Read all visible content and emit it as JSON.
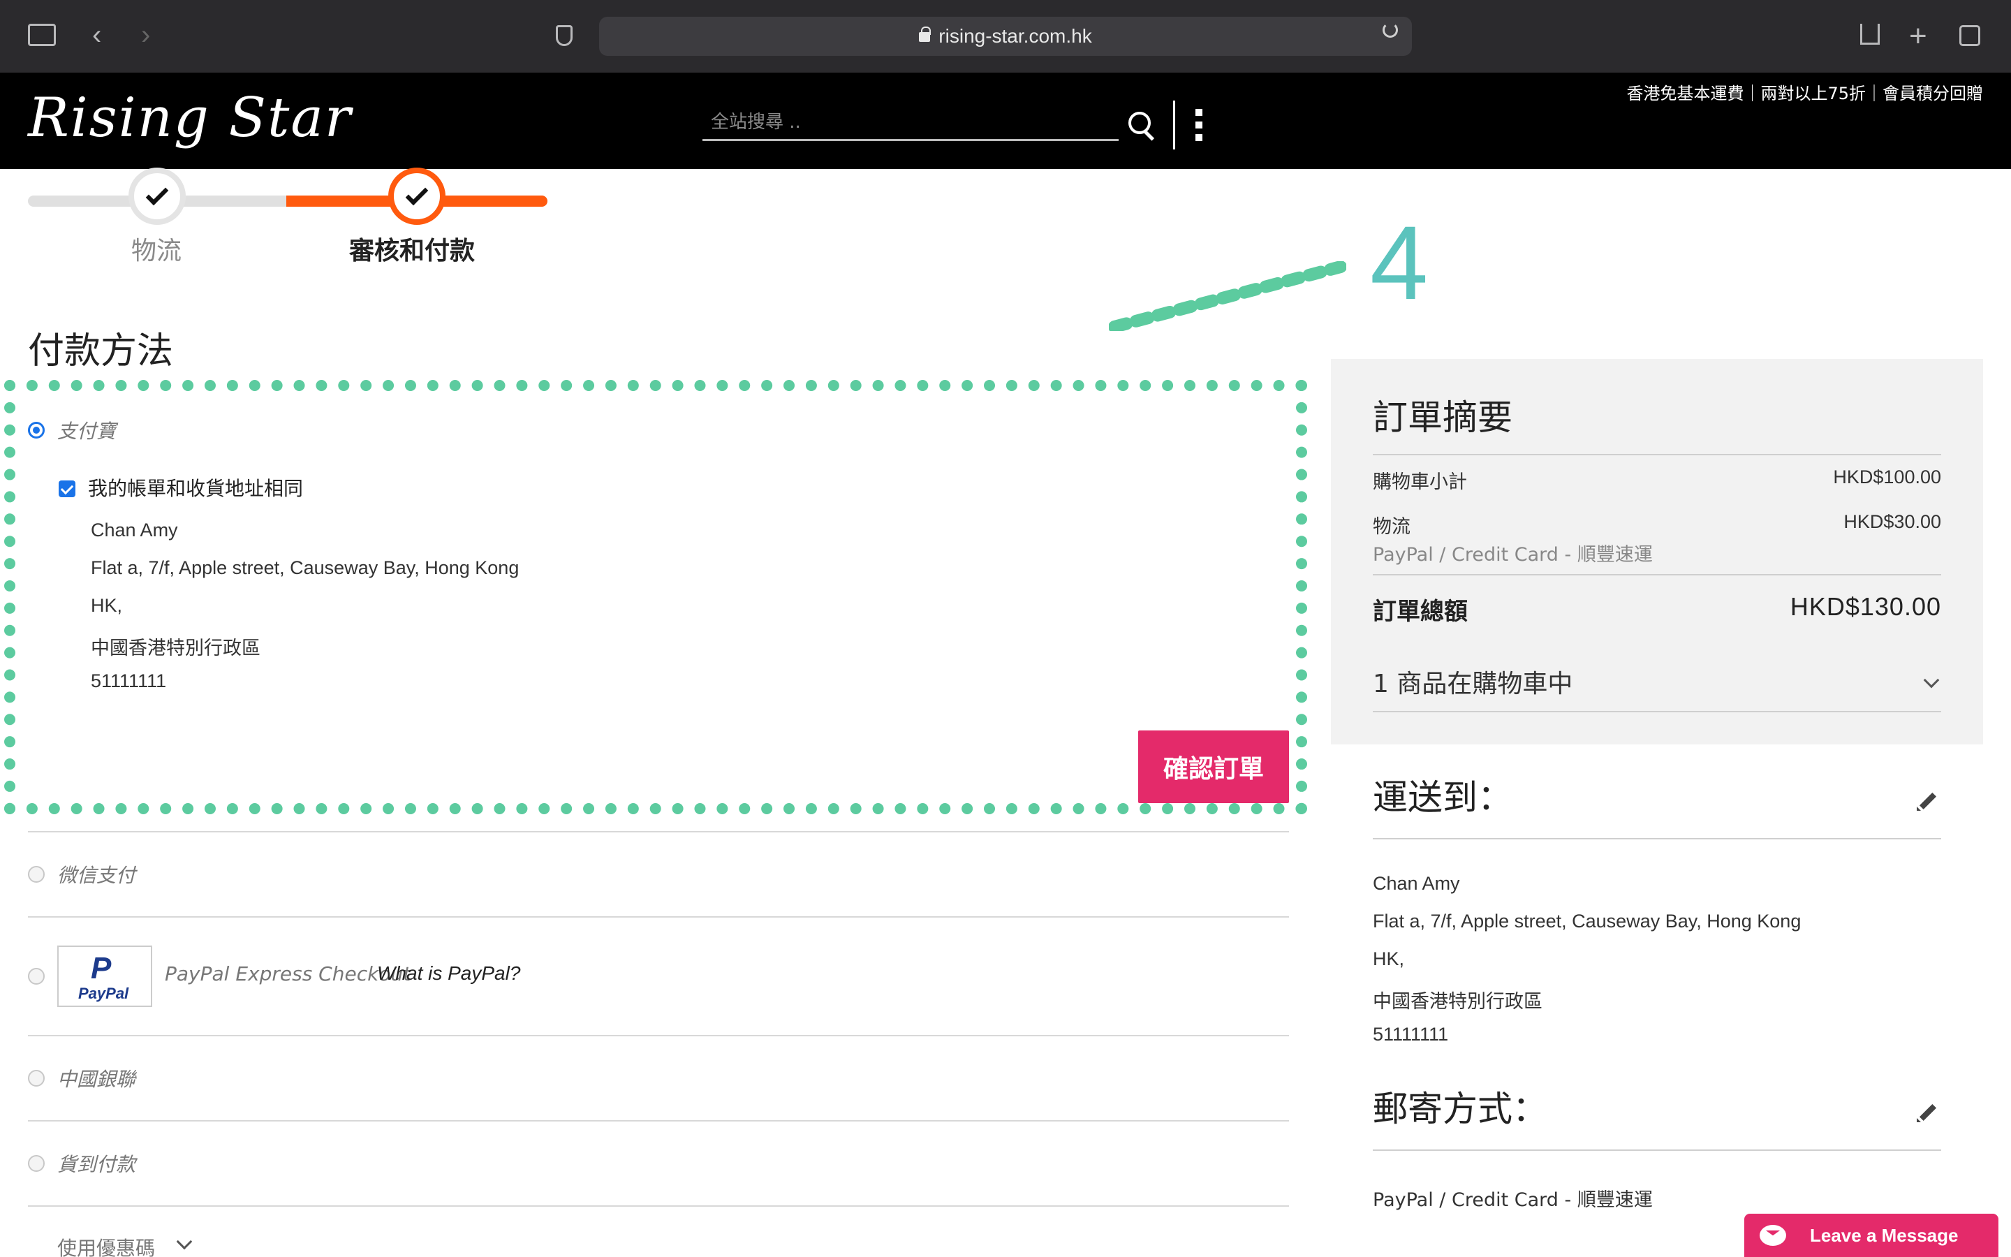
{
  "browser": {
    "url": "rising-star.com.hk"
  },
  "header": {
    "logo_text": "Rising Star",
    "search_placeholder": "全站搜尋 ..",
    "promo": "香港免基本運費｜兩對以上75折｜會員積分回贈"
  },
  "progress": {
    "steps": [
      {
        "label": "物流",
        "status": "done"
      },
      {
        "label": "審核和付款",
        "status": "active"
      }
    ]
  },
  "annotation": {
    "number": "4",
    "color": "#5ccb9f"
  },
  "payment": {
    "title": "付款方法",
    "methods": [
      {
        "label": "支付寶",
        "selected": true
      },
      {
        "label": "微信支付",
        "selected": false
      },
      {
        "label": "PayPal Express Checkout",
        "selected": false
      },
      {
        "label": "中國銀聯",
        "selected": false
      },
      {
        "label": "貨到付款",
        "selected": false
      }
    ],
    "paypal_logo_text": "PayPal",
    "paypal_what": "What is PayPal?",
    "same_address_label": "我的帳單和收貨地址相同",
    "address_lines": [
      "Chan Amy",
      "Flat a, 7/f, Apple street, Causeway Bay, Hong Kong",
      "HK,",
      "中國香港特別行政區",
      "51111111"
    ],
    "confirm_button": "確認訂單",
    "coupon_label": "使用優惠碼"
  },
  "summary": {
    "title": "訂單摘要",
    "subtotal_label": "購物車小計",
    "subtotal_value": "HKD$100.00",
    "shipping_label": "物流",
    "shipping_value": "HKD$30.00",
    "shipping_method": "PayPal / Credit Card - 順豐速運",
    "total_label": "訂單總額",
    "total_value": "HKD$130.00",
    "items_count": "1 商品在購物車中"
  },
  "ship_to": {
    "title": "運送到：",
    "lines": [
      "Chan Amy",
      "Flat a, 7/f, Apple street, Causeway Bay, Hong Kong",
      "HK,",
      "中國香港特別行政區",
      "51111111"
    ]
  },
  "shipping_method": {
    "title": "郵寄方式：",
    "value": "PayPal / Credit Card - 順豐速運"
  },
  "chat": {
    "label": "Leave a Message"
  },
  "colors": {
    "accent_orange": "#ff5a0e",
    "brand_pink": "#e42a6a",
    "radio_blue": "#1a73e8"
  }
}
